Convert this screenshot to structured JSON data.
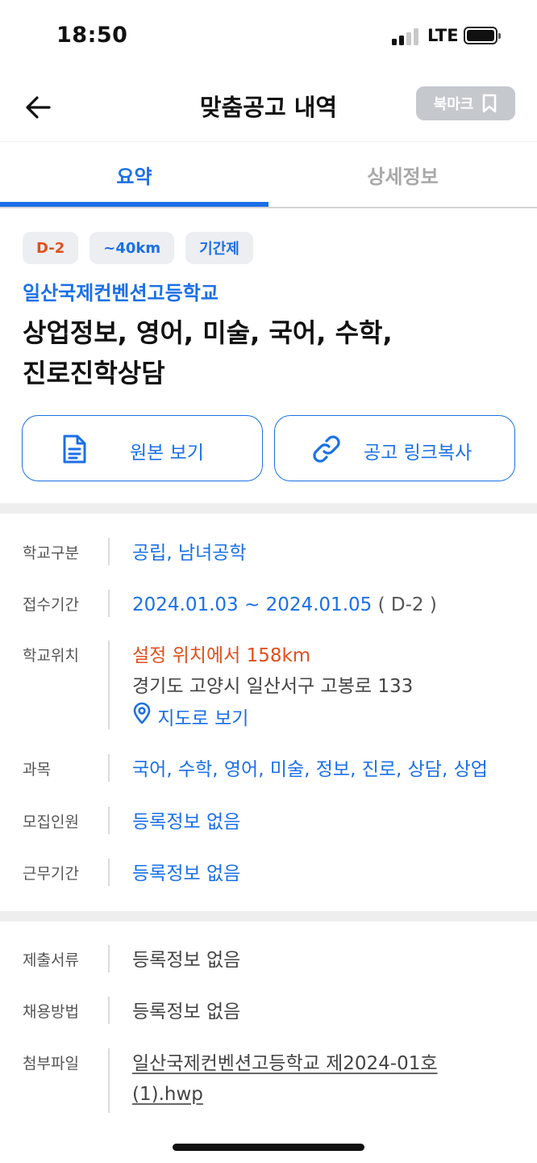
{
  "status_bar": {
    "time": "18:50",
    "network": "LTE"
  },
  "header": {
    "title": "맞춤공고 내역",
    "bookmark_label": "북마크"
  },
  "tabs": [
    {
      "label": "요약",
      "active": true
    },
    {
      "label": "상세정보",
      "active": false
    }
  ],
  "chips": [
    {
      "label": "D-2"
    },
    {
      "label": "~40km"
    },
    {
      "label": "기간제"
    }
  ],
  "posting": {
    "school_name": "일산국제컨벤션고등학교",
    "title": "상업정보, 영어, 미술, 국어, 수학, 진로진학상담"
  },
  "actions": {
    "view_original": "원본 보기",
    "copy_link": "공고 링크복사"
  },
  "info": {
    "school_type": {
      "label": "학교구분",
      "value": "공립, 남녀공학"
    },
    "application_period": {
      "label": "접수기간",
      "value": "2024.01.03 ~ 2024.01.05",
      "dday": "( D-2 )"
    },
    "location": {
      "label": "학교위치",
      "distance": "설정 위치에서 158km",
      "address": "경기도 고양시 일산서구 고봉로 133",
      "map_link": "지도로 보기"
    },
    "subjects": {
      "label": "과목",
      "value": "국어, 수학, 영어, 미술, 정보, 진로, 상담, 상업"
    },
    "recruit_count": {
      "label": "모집인원",
      "value": "등록정보 없음"
    },
    "work_period": {
      "label": "근무기간",
      "value": "등록정보 없음"
    }
  },
  "extra_info": {
    "documents": {
      "label": "제출서류",
      "value": "등록정보 없음"
    },
    "hiring_method": {
      "label": "채용방법",
      "value": "등록정보 없음"
    },
    "attachments": {
      "label": "첨부파일",
      "file_name": "일산국제컨벤션고등학교 제2024-01호(1).hwp"
    }
  },
  "colors": {
    "accent": "#1b70e6",
    "dday": "#e0501d",
    "chip_bg": "#eceef1",
    "bookmark_bg": "#c5c8cd"
  }
}
